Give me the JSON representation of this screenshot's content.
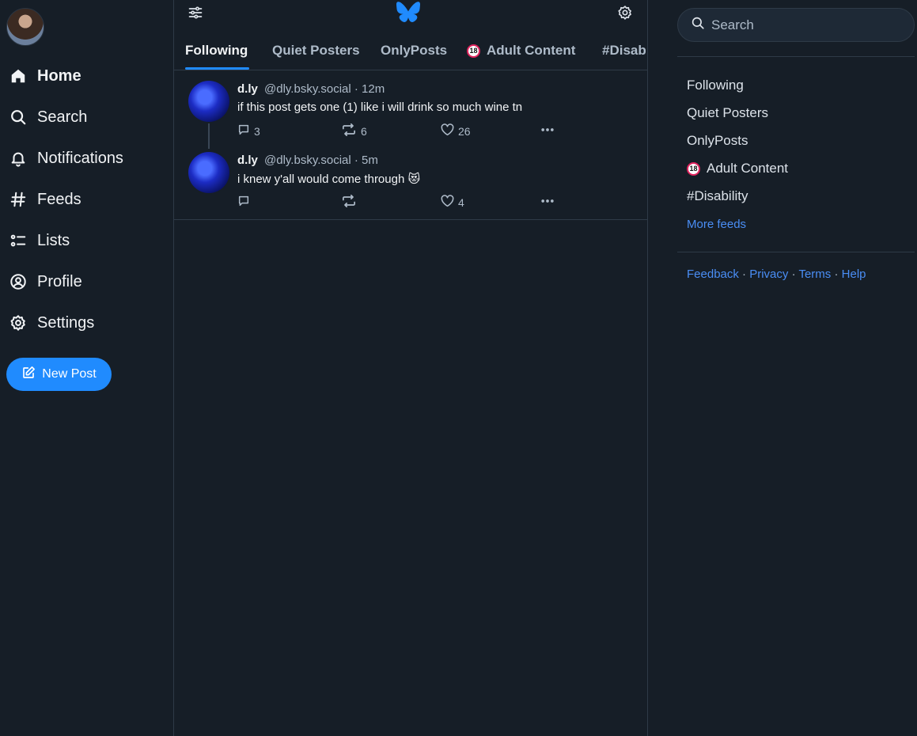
{
  "nav": {
    "items": [
      {
        "label": "Home",
        "icon": "home-icon"
      },
      {
        "label": "Search",
        "icon": "search-icon"
      },
      {
        "label": "Notifications",
        "icon": "bell-icon"
      },
      {
        "label": "Feeds",
        "icon": "hash-icon"
      },
      {
        "label": "Lists",
        "icon": "list-icon"
      },
      {
        "label": "Profile",
        "icon": "user-circle-icon"
      },
      {
        "label": "Settings",
        "icon": "gear-icon"
      }
    ],
    "new_post_label": "New Post"
  },
  "tabs": [
    {
      "label": "Following"
    },
    {
      "label": "Quiet Posters"
    },
    {
      "label": "OnlyPosts"
    },
    {
      "label": "Adult Content",
      "badge": "18"
    },
    {
      "label": "#Disab"
    }
  ],
  "posts": [
    {
      "name": "d.ly",
      "handle": "@dly.bsky.social",
      "time": "· 12m",
      "text": "if this post gets one (1) like i will drink so much wine tn",
      "replies": "3",
      "reposts": "6",
      "likes": "26"
    },
    {
      "name": "d.ly",
      "handle": "@dly.bsky.social",
      "time": "· 5m",
      "text": "i knew y'all would come through 😻",
      "replies": "",
      "reposts": "",
      "likes": "4"
    }
  ],
  "right": {
    "search_placeholder": "Search",
    "feeds": [
      {
        "label": "Following"
      },
      {
        "label": "Quiet Posters"
      },
      {
        "label": "OnlyPosts"
      },
      {
        "label": "Adult Content",
        "badge": "18"
      },
      {
        "label": "#Disability"
      }
    ],
    "more_feeds": "More feeds",
    "footer": {
      "feedback": "Feedback",
      "privacy": "Privacy",
      "terms": "Terms",
      "help": "Help",
      "sep": " · "
    }
  },
  "colors": {
    "accent": "#208bfe",
    "background": "#161e27",
    "link": "#4a8ef5"
  }
}
